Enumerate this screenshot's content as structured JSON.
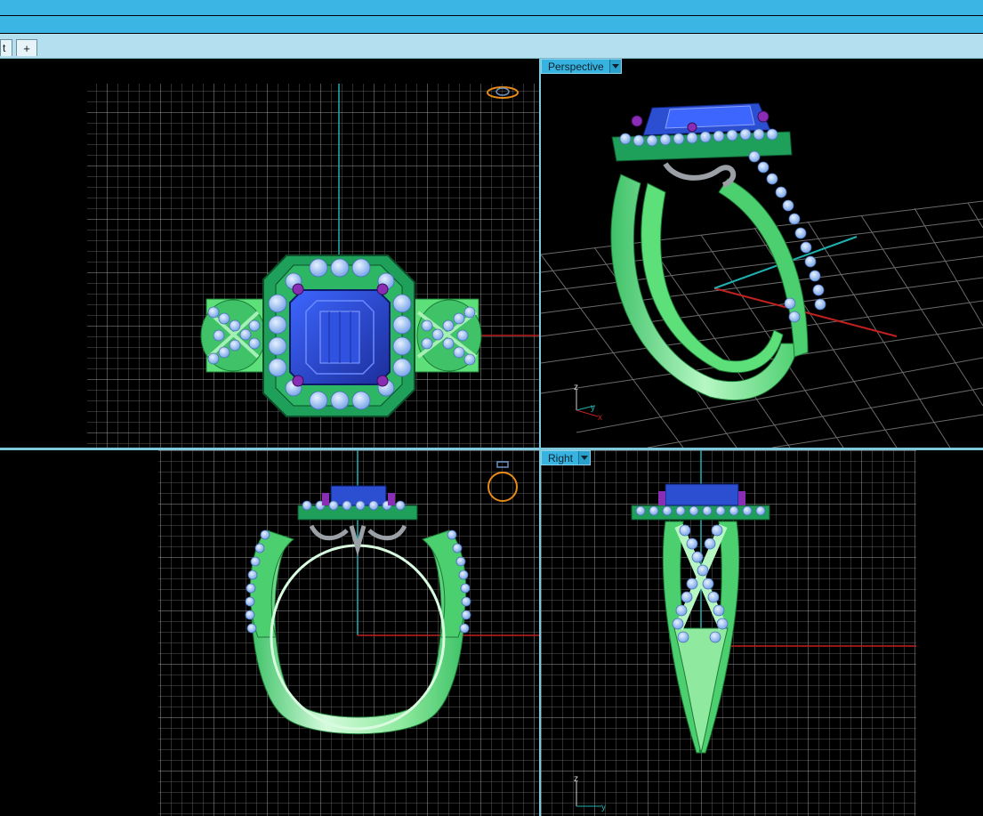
{
  "tabs": [
    {
      "label": "t"
    },
    {
      "label": "+"
    }
  ],
  "viewports": {
    "top": {
      "label": ""
    },
    "perspective": {
      "label": "Perspective"
    },
    "front": {
      "label": ""
    },
    "right": {
      "label": "Right"
    }
  },
  "axis_labels": {
    "z": "z",
    "y": "y",
    "x": "x"
  },
  "colors": {
    "ui_accent": "#3bb5e3",
    "gem": "#2b4fd0",
    "metal": "#5de07a",
    "halo_stones": "#8ab8f0",
    "prongs": "#8a2db5",
    "axis_x": "#c02020",
    "axis_y": "#20b0b0",
    "grid": "#8c8c8c"
  }
}
